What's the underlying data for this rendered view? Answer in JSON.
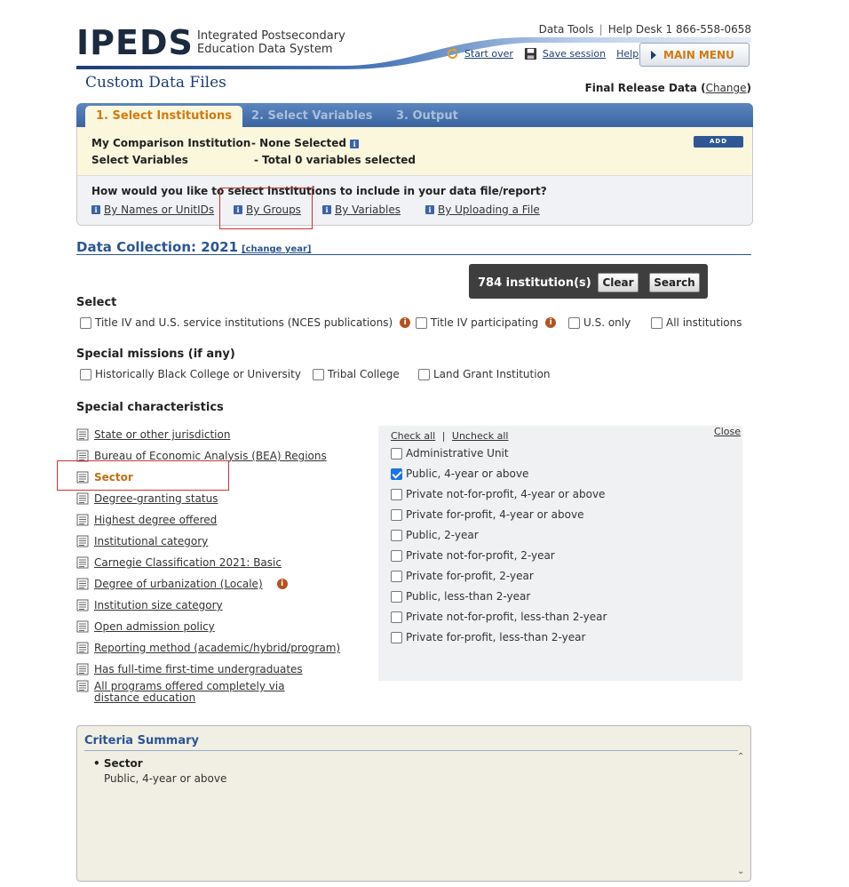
{
  "header": {
    "logo": "IPEDS",
    "subtitle_line1": "Integrated Postsecondary",
    "subtitle_line2": "Education Data System",
    "data_tools": "Data Tools",
    "help_desk": "Help Desk 1 866-558-0658",
    "start_over": "Start over",
    "save_session": "Save session",
    "help": "Help",
    "main_menu": "MAIN MENU"
  },
  "page": {
    "title": "Custom Data Files",
    "final_release_label": "Final Release Data",
    "change_label": "Change"
  },
  "tabs": [
    {
      "label": "1. Select Institutions",
      "active": true
    },
    {
      "label": "2. Select Variables",
      "active": false
    },
    {
      "label": "3. Output",
      "active": false
    }
  ],
  "selection": {
    "comparison_label": "My Comparison Institution",
    "comparison_value": "- None Selected",
    "variables_label": "Select Variables",
    "variables_value": "- Total 0 variables selected",
    "add_label": "ADD"
  },
  "how": {
    "question": "How would you like to select institutions to include in your data file/report?",
    "options": [
      "By Names or UnitIDs",
      "By Groups",
      "By Variables",
      "By Uploading a File"
    ]
  },
  "data_collection": {
    "title": "Data Collection: 2021",
    "change_year": "[change year]"
  },
  "results": {
    "count": "784 institution(s)",
    "clear": "Clear",
    "search": "Search"
  },
  "select_section": {
    "heading": "Select",
    "options": [
      "Title IV and U.S. service institutions (NCES publications)",
      "Title IV participating",
      "U.S. only",
      "All institutions"
    ]
  },
  "missions": {
    "heading": "Special missions (if any)",
    "options": [
      "Historically Black College or University",
      "Tribal College",
      "Land Grant Institution"
    ]
  },
  "characteristics": {
    "heading": "Special characteristics",
    "items": [
      "State or other jurisdiction",
      "Bureau of Economic Analysis (BEA) Regions",
      "Sector",
      "Degree-granting status",
      "Highest degree offered",
      "Institutional category",
      "Carnegie Classification 2021: Basic",
      "Degree of urbanization (Locale)",
      "Institution size category",
      "Open admission policy",
      "Reporting method (academic/hybrid/program)",
      "Has full-time first-time undergraduates",
      "All programs offered completely via distance education"
    ],
    "active_index": 2
  },
  "sector_panel": {
    "check_all": "Check all",
    "uncheck_all": "Uncheck all",
    "close": "Close",
    "options": [
      {
        "label": "Administrative Unit",
        "checked": false
      },
      {
        "label": "Public, 4-year or above",
        "checked": true
      },
      {
        "label": "Private not-for-profit, 4-year or above",
        "checked": false
      },
      {
        "label": "Private for-profit, 4-year or above",
        "checked": false
      },
      {
        "label": "Public, 2-year",
        "checked": false
      },
      {
        "label": "Private not-for-profit, 2-year",
        "checked": false
      },
      {
        "label": "Private for-profit, 2-year",
        "checked": false
      },
      {
        "label": "Public, less-than 2-year",
        "checked": false
      },
      {
        "label": "Private not-for-profit, less-than 2-year",
        "checked": false
      },
      {
        "label": "Private for-profit, less-than 2-year",
        "checked": false
      }
    ]
  },
  "criteria": {
    "title": "Criteria Summary",
    "item_name": "Sector",
    "item_value": "Public, 4-year or above"
  }
}
